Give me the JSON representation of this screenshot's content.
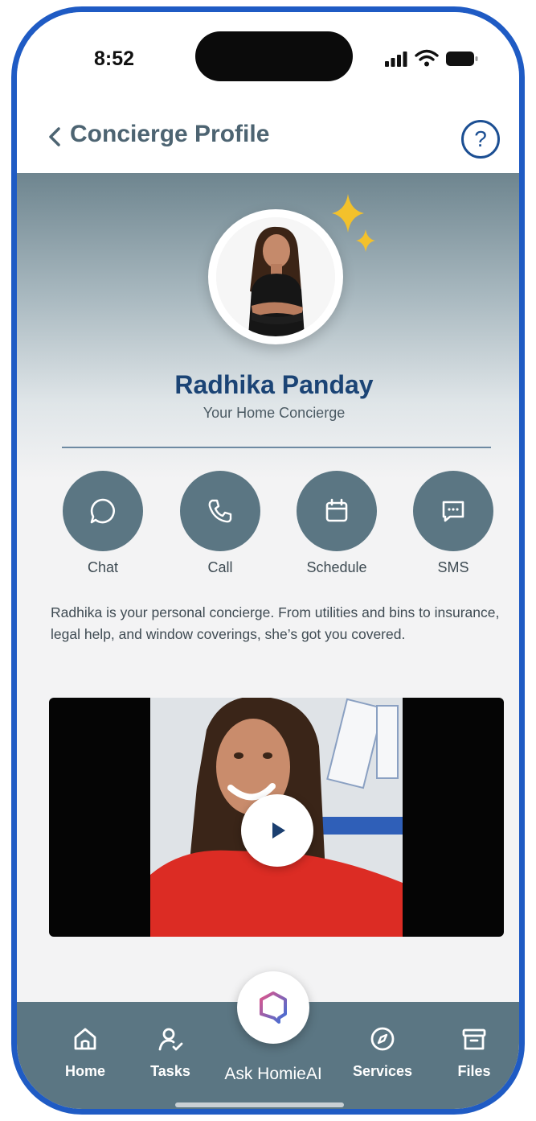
{
  "status_bar": {
    "time": "8:52"
  },
  "header": {
    "title": "Concierge Profile",
    "help_icon": "question-icon"
  },
  "profile": {
    "name": "Radhika Panday",
    "role": "Your Home Concierge"
  },
  "actions": [
    {
      "label": "Chat",
      "icon": "chat-bubble-icon"
    },
    {
      "label": "Call",
      "icon": "phone-icon"
    },
    {
      "label": "Schedule",
      "icon": "calendar-icon"
    },
    {
      "label": "SMS",
      "icon": "message-icon"
    }
  ],
  "description": "Radhika is your personal  concierge. From utilities and bins to insurance, legal help, and window coverings, she’s got you covered.",
  "video": {
    "play_icon": "play-icon"
  },
  "tabbar": {
    "items": [
      {
        "label": "Home",
        "icon": "home-icon"
      },
      {
        "label": "Tasks",
        "icon": "tasks-icon"
      },
      {
        "label": "Ask HomieAI",
        "icon": "homieai-logo"
      },
      {
        "label": "Services",
        "icon": "compass-icon"
      },
      {
        "label": "Files",
        "icon": "archive-icon"
      }
    ]
  },
  "colors": {
    "accent_frame": "#1f5bc4",
    "slate": "#5b7683",
    "name_blue": "#1b4475"
  }
}
